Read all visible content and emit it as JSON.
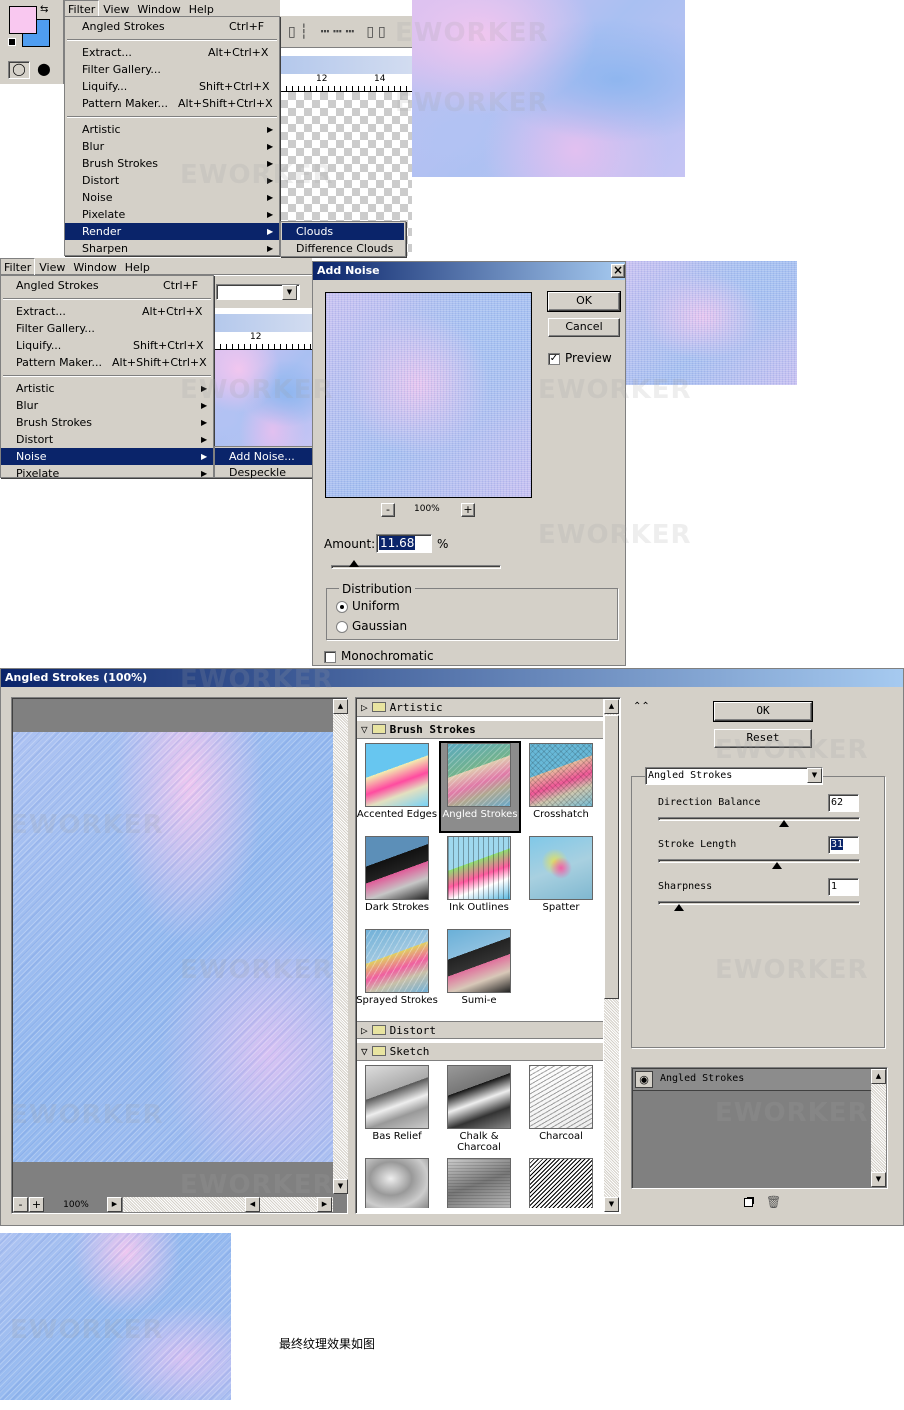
{
  "s1": {
    "menubar": [
      "Filter",
      "View",
      "Window",
      "Help"
    ],
    "last": {
      "label": "Angled Strokes",
      "shortcut": "Ctrl+F"
    },
    "items": [
      {
        "label": "Extract...",
        "shortcut": "Alt+Ctrl+X"
      },
      {
        "label": "Filter Gallery..."
      },
      {
        "label": "Liquify...",
        "shortcut": "Shift+Ctrl+X"
      },
      {
        "label": "Pattern Maker...",
        "shortcut": "Alt+Shift+Ctrl+X"
      }
    ],
    "cats": [
      "Artistic",
      "Blur",
      "Brush Strokes",
      "Distort",
      "Noise",
      "Pixelate",
      "Render",
      "Sharpen"
    ],
    "submenu": [
      "Clouds",
      "Difference Clouds"
    ],
    "ruler": [
      "12",
      "14"
    ]
  },
  "s2": {
    "menubar": [
      "Filter",
      "View",
      "Window",
      "Help"
    ],
    "last": {
      "label": "Angled Strokes",
      "shortcut": "Ctrl+F"
    },
    "items": [
      {
        "label": "Extract...",
        "shortcut": "Alt+Ctrl+X"
      },
      {
        "label": "Filter Gallery..."
      },
      {
        "label": "Liquify...",
        "shortcut": "Shift+Ctrl+X"
      },
      {
        "label": "Pattern Maker...",
        "shortcut": "Alt+Shift+Ctrl+X"
      }
    ],
    "cats": [
      "Artistic",
      "Blur",
      "Brush Strokes",
      "Distort",
      "Noise",
      "Pixelate"
    ],
    "submenu": [
      "Add Noise...",
      "Despeckle"
    ],
    "ruler": [
      "12"
    ]
  },
  "addnoise": {
    "title": "Add Noise",
    "close": "×",
    "ok": "OK",
    "cancel": "Cancel",
    "preview": "Preview",
    "zoom": "100%",
    "minus": "-",
    "plus": "+",
    "amount_label": "Amount:",
    "amount": "11.68",
    "percent": "%",
    "distribution": "Distribution",
    "uniform": "Uniform",
    "gaussian": "Gaussian",
    "mono": "Monochromatic"
  },
  "gallery": {
    "title": "Angled Strokes (100%)",
    "zoom": "100%",
    "folders": {
      "artistic": "Artistic",
      "brush": "Brush Strokes",
      "distort": "Distort",
      "sketch": "Sketch"
    },
    "brush_items": [
      "Accented Edges",
      "Angled Strokes",
      "Crosshatch",
      "Dark Strokes",
      "Ink Outlines",
      "Spatter",
      "Sprayed Strokes",
      "Sumi-e"
    ],
    "sketch_items": [
      "Bas Relief",
      "Chalk & Charcoal",
      "Charcoal"
    ],
    "ok": "OK",
    "reset": "Reset",
    "filter_select": "Angled Strokes",
    "params": [
      {
        "label": "Direction Balance",
        "value": "62",
        "frac": 0.62
      },
      {
        "label": "Stroke Length",
        "value": "31",
        "frac": 0.6
      },
      {
        "label": "Sharpness",
        "value": "1",
        "frac": 0.1
      }
    ],
    "layer": "Angled Strokes"
  },
  "caption": "最终纹理效果如图",
  "watermark": "EWORKER"
}
